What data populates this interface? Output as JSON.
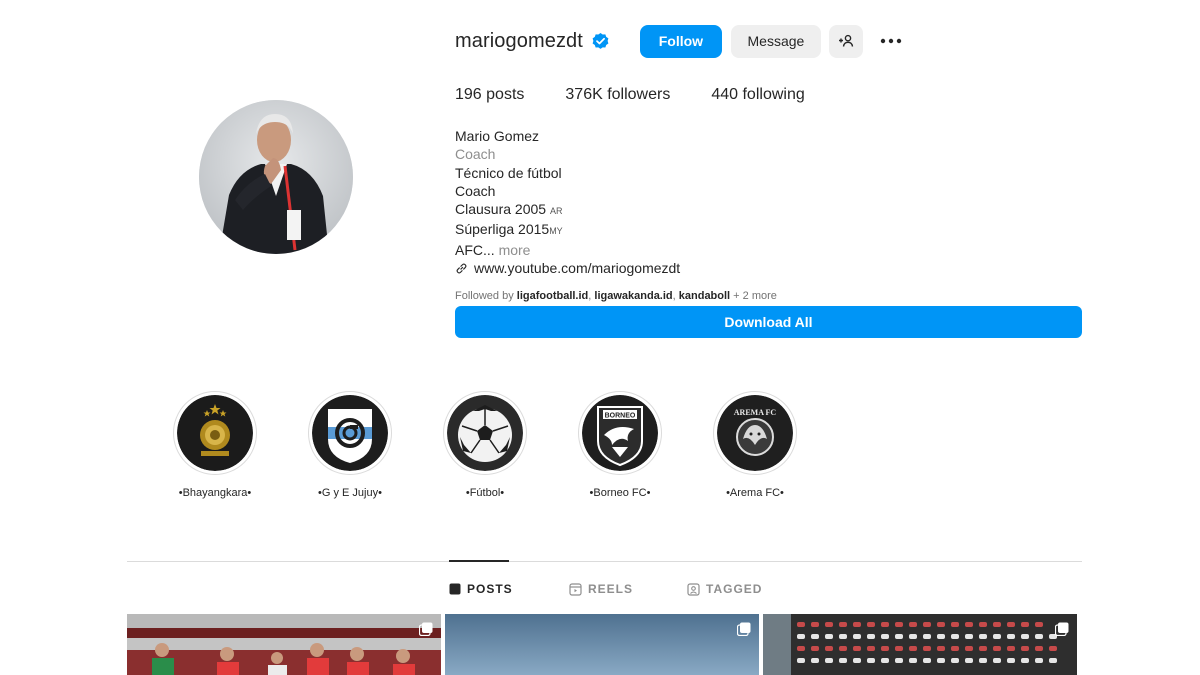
{
  "profile": {
    "username": "mariogomezdt",
    "verified": true,
    "follow_label": "Follow",
    "message_label": "Message",
    "more_icon": "more-options-icon",
    "suggest_icon": "add-user-icon"
  },
  "stats": {
    "posts": "196 posts",
    "followers": "376K followers",
    "following": "440 following"
  },
  "bio": {
    "name": "Mario Gomez",
    "category": "Coach",
    "lines": [
      "Técnico de fútbol",
      "Coach"
    ],
    "clausura": "Clausura 2005",
    "clausura_tag": "AR",
    "superliga": "Súperliga 2015",
    "superliga_tag": "MY",
    "truncated": "AFC...",
    "more": "more",
    "link": "www.youtube.com/mariogomezdt"
  },
  "followed_by": {
    "prefix": "Followed by",
    "accounts": [
      "ligafootball.id",
      "ligawakanda.id",
      "kandaboll"
    ],
    "suffix": "+ 2 more"
  },
  "download_label": "Download All",
  "highlights": [
    {
      "label": "•Bhayangkara•"
    },
    {
      "label": "•G y E Jujuy•"
    },
    {
      "label": "•Fútbol•"
    },
    {
      "label": "•Borneo FC•"
    },
    {
      "label": "•Arema FC•"
    }
  ],
  "highlight_texts": {
    "borneo": "BORNEO",
    "arema": "AREMA FC"
  },
  "tabs": [
    {
      "label": "POSTS",
      "active": true
    },
    {
      "label": "REELS",
      "active": false
    },
    {
      "label": "TAGGED",
      "active": false
    }
  ],
  "colors": {
    "accent": "#0095f6",
    "text": "#262626",
    "muted": "#8e8e8e",
    "border": "#dbdbdb"
  }
}
